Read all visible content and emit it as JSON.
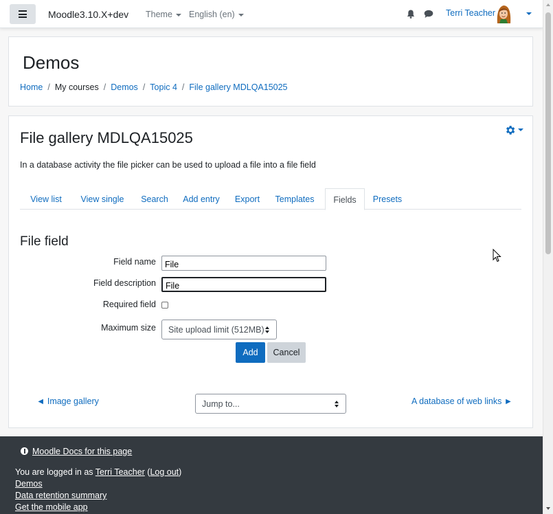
{
  "navbar": {
    "brand": "Moodle3.10.X+dev",
    "theme_label": "Theme",
    "language_label": "English (en)",
    "user_name": "Terri Teacher"
  },
  "header": {
    "course_title": "Demos",
    "breadcrumb": [
      "Home",
      "My courses",
      "Demos",
      "Topic 4",
      "File gallery MDLQA15025"
    ]
  },
  "activity": {
    "title": "File gallery MDLQA15025",
    "intro": "In a database activity the file picker can be used to upload a file into a file field",
    "tabs": [
      "View list",
      "View single",
      "Search",
      "Add entry",
      "Export",
      "Templates",
      "Fields",
      "Presets"
    ],
    "active_tab": "Fields"
  },
  "form": {
    "section_title": "File field",
    "field_name_label": "Field name",
    "field_name_value": "File",
    "field_description_label": "Field description",
    "field_description_value": "File",
    "required_label": "Required field",
    "required_checked": false,
    "max_size_label": "Maximum size",
    "max_size_value": "Site upload limit (512MB)",
    "add_button": "Add",
    "cancel_button": "Cancel"
  },
  "activity_nav": {
    "prev": "◄ Image gallery",
    "jump_placeholder": "Jump to...",
    "next": "A database of web links ►"
  },
  "footer": {
    "docs_link": "Moodle Docs for this page",
    "logged_in_prefix": "You are logged in as ",
    "logged_in_user": "Terri Teacher",
    "logout_open": " (",
    "logout_link": "Log out",
    "logout_close": ")",
    "demos_link": "Demos",
    "retention_link": "Data retention summary",
    "mobile_app_link": "Get the mobile app"
  },
  "colors": {
    "primary": "#0f6cbf",
    "footer_bg": "#343a40",
    "page_bg": "#f7f7f7"
  },
  "icons": [
    "hamburger-icon",
    "bell-icon",
    "chat-icon",
    "avatar",
    "gear-icon",
    "info-icon",
    "cursor-icon"
  ]
}
